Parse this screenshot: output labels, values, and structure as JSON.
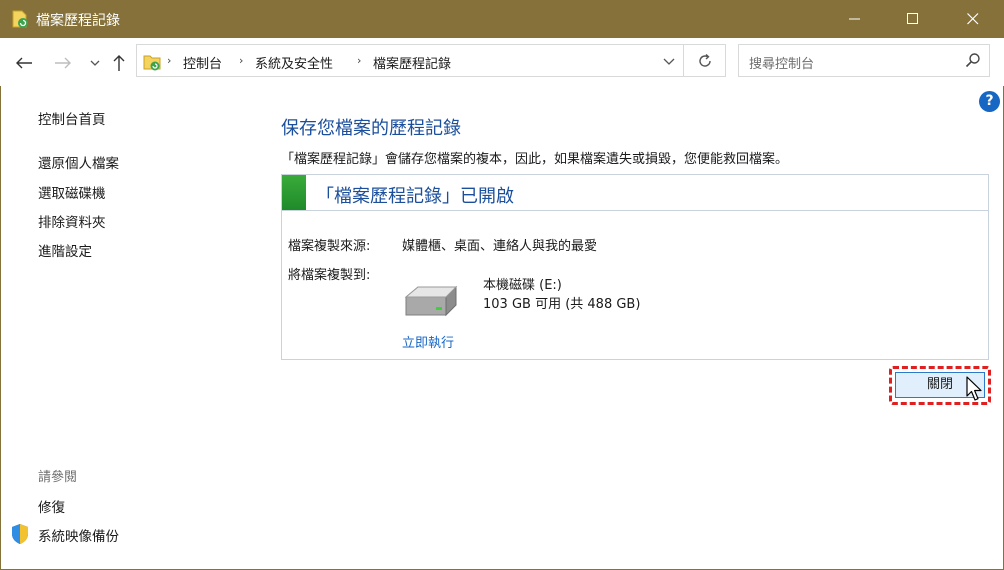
{
  "window": {
    "title": "檔案歷程記錄",
    "title_bar_color": "#857139",
    "controls": {
      "minimize": "minimize-icon",
      "maximize": "maximize-icon",
      "close": "close-icon"
    }
  },
  "address_bar": {
    "breadcrumbs": [
      "控制台",
      "系統及安全性",
      "檔案歷程記錄"
    ],
    "separator": "›",
    "search_placeholder": "搜尋控制台"
  },
  "sidebar": {
    "items": [
      {
        "label": "控制台首頁"
      },
      {
        "label": "還原個人檔案"
      },
      {
        "label": "選取磁碟機"
      },
      {
        "label": "排除資料夾"
      },
      {
        "label": "進階設定"
      }
    ],
    "see_also_heading": "請參閱",
    "see_also": [
      {
        "label": "修復"
      },
      {
        "label": "系統映像備份"
      }
    ]
  },
  "main": {
    "title": "保存您檔案的歷程記錄",
    "description": "「檔案歷程記錄」會儲存您檔案的複本，因此，如果檔案遺失或損毀，您便能救回檔案。",
    "status_text": "「檔案歷程記錄」已開啟",
    "status_color": "#2a9a34",
    "copy_source_label": "檔案複製來源:",
    "copy_source_value": "媒體櫃、桌面、連絡人與我的最愛",
    "copy_dest_label": "將檔案複製到:",
    "drive_name": "本機磁碟 (E:)",
    "drive_size": "103 GB 可用 (共 488 GB)",
    "run_now": "立即執行",
    "close_button": "關閉",
    "help": "?"
  },
  "accent_color": "#1666c4"
}
